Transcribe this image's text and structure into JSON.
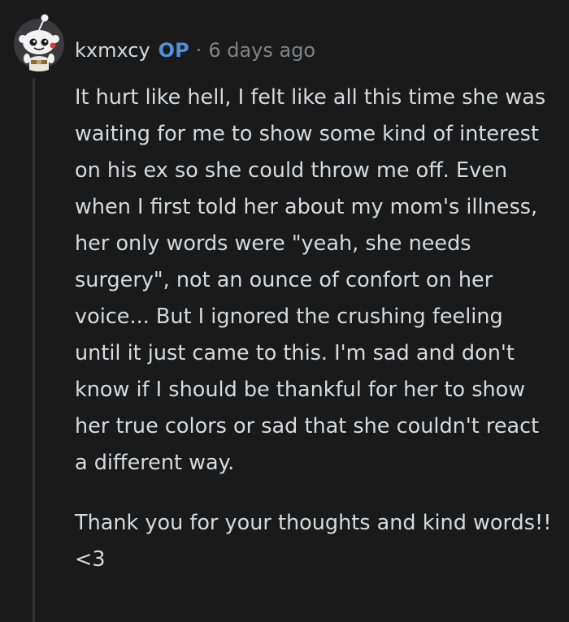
{
  "comment": {
    "author": "kxmxcy",
    "op_badge": "OP",
    "separator": "·",
    "timestamp": "6 days ago",
    "avatar_icon": "snoo-avatar-icon",
    "paragraphs": [
      "It hurt like hell, I felt like all this time she was waiting for me to show some kind of interest on his ex so she could throw me off. Even when I first told her about my mom's illness, her only words were \"yeah, she needs surgery\", not an ounce of confort on her voice... But I ignored the crushing feeling until it just came to this. I'm sad and don't know if I should be thankful for her to show her true colors or sad that she couldn't react a different way.",
      "Thank you for your thoughts and kind words!! <3"
    ]
  },
  "colors": {
    "background": "#1a1a1b",
    "text": "#d7dadc",
    "op_badge": "#4f8fdc",
    "muted": "#818384",
    "thread_line": "#343536"
  }
}
